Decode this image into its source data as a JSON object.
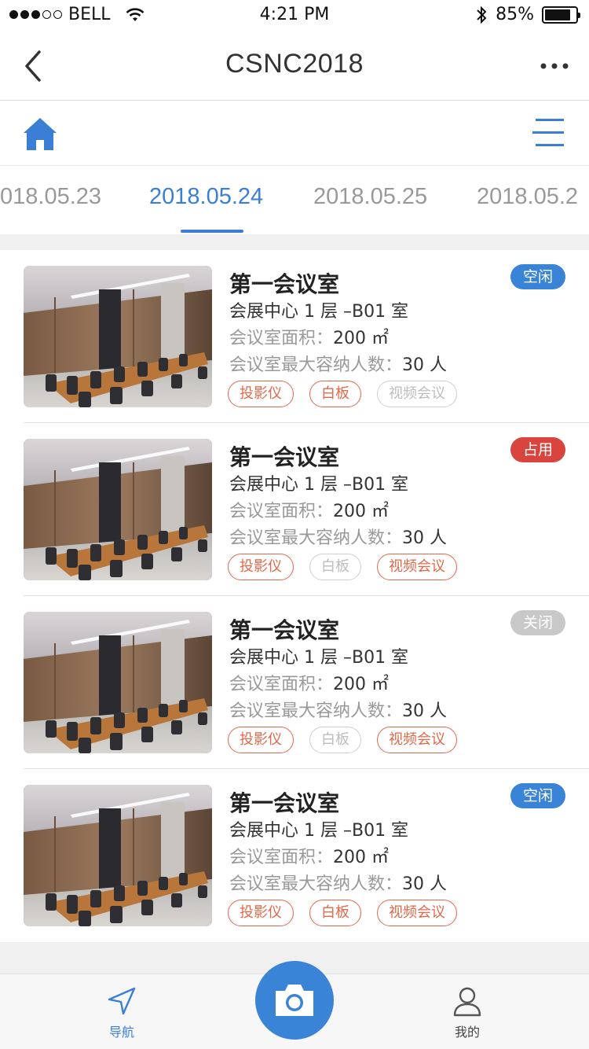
{
  "status_bar": {
    "carrier": "BELL",
    "time": "4:21 PM",
    "battery": "85%",
    "battery_level": 0.85
  },
  "nav": {
    "title": "CSNC2018",
    "back_icon": "chevron-left-icon",
    "more_icon": "ellipsis-icon"
  },
  "toolbar": {
    "home_icon": "home-icon",
    "menu_icon": "menu-lines-icon"
  },
  "date_tabs": [
    "018.05.23",
    "2018.05.24",
    "2018.05.25",
    "2018.05.2"
  ],
  "active_tab_index": 1,
  "colors": {
    "accent": "#3a7fd5",
    "free": "#3a84d8",
    "occupied": "#d9443e",
    "closed": "#c8c8c8",
    "tag_active": "#e2684a",
    "tag_inactive": "#cfcfcf"
  },
  "rooms": [
    {
      "name": "第一会议室",
      "location": "会展中心 1 层 –B01 室",
      "area_label": "会议室面积：",
      "area_value": "200 ㎡",
      "capacity_label": "会议室最大容纳人数：",
      "capacity_value": "30 人",
      "status": "空闲",
      "status_type": "free",
      "tags": [
        {
          "label": "投影仪",
          "enabled": true
        },
        {
          "label": "白板",
          "enabled": true
        },
        {
          "label": "视频会议",
          "enabled": false
        }
      ]
    },
    {
      "name": "第一会议室",
      "location": "会展中心 1 层 –B01 室",
      "area_label": "会议室面积：",
      "area_value": "200 ㎡",
      "capacity_label": "会议室最大容纳人数：",
      "capacity_value": "30 人",
      "status": "占用",
      "status_type": "occupied",
      "tags": [
        {
          "label": "投影仪",
          "enabled": true
        },
        {
          "label": "白板",
          "enabled": false
        },
        {
          "label": "视频会议",
          "enabled": true
        }
      ]
    },
    {
      "name": "第一会议室",
      "location": "会展中心 1 层 –B01 室",
      "area_label": "会议室面积：",
      "area_value": "200 ㎡",
      "capacity_label": "会议室最大容纳人数：",
      "capacity_value": "30 人",
      "status": "关闭",
      "status_type": "closed",
      "tags": [
        {
          "label": "投影仪",
          "enabled": true
        },
        {
          "label": "白板",
          "enabled": false
        },
        {
          "label": "视频会议",
          "enabled": true
        }
      ]
    },
    {
      "name": "第一会议室",
      "location": "会展中心 1 层 –B01 室",
      "area_label": "会议室面积：",
      "area_value": "200 ㎡",
      "capacity_label": "会议室最大容纳人数：",
      "capacity_value": "30 人",
      "status": "空闲",
      "status_type": "free",
      "tags": [
        {
          "label": "投影仪",
          "enabled": true
        },
        {
          "label": "白板",
          "enabled": true
        },
        {
          "label": "视频会议",
          "enabled": true
        }
      ]
    }
  ],
  "tab_bar": {
    "nav_label": "导航",
    "nav_icon": "navigation-arrow-icon",
    "camera_icon": "camera-icon",
    "mine_label": "我的",
    "mine_icon": "user-icon"
  }
}
